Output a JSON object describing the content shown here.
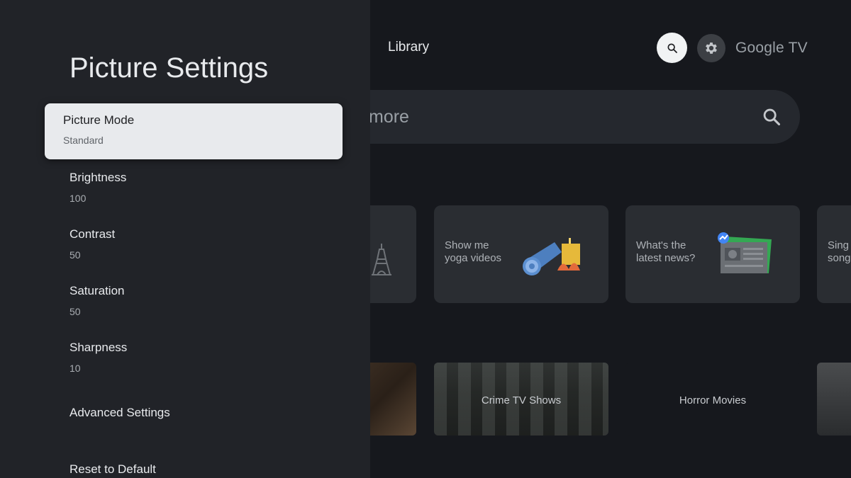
{
  "background": {
    "nav": {
      "library": "Library"
    },
    "brand": "Google TV",
    "search": {
      "placeholder_tail": "more"
    },
    "cards": [
      {
        "text": ""
      },
      {
        "text": "Show me\nyoga videos"
      },
      {
        "text": "What's the\nlatest news?"
      },
      {
        "text": "Sing\nsong"
      }
    ],
    "row2": [
      {
        "label": ""
      },
      {
        "label": "Crime TV Shows"
      },
      {
        "label": "Horror Movies"
      },
      {
        "label": ""
      }
    ]
  },
  "panel": {
    "title": "Picture Settings",
    "items": [
      {
        "label": "Picture Mode",
        "value": "Standard"
      },
      {
        "label": "Brightness",
        "value": "100"
      },
      {
        "label": "Contrast",
        "value": "50"
      },
      {
        "label": "Saturation",
        "value": "50"
      },
      {
        "label": "Sharpness",
        "value": "10"
      },
      {
        "label": "Advanced Settings"
      },
      {
        "label": "Reset to Default"
      }
    ]
  },
  "icons": {
    "search": "search-icon",
    "settings": "gear-icon"
  }
}
